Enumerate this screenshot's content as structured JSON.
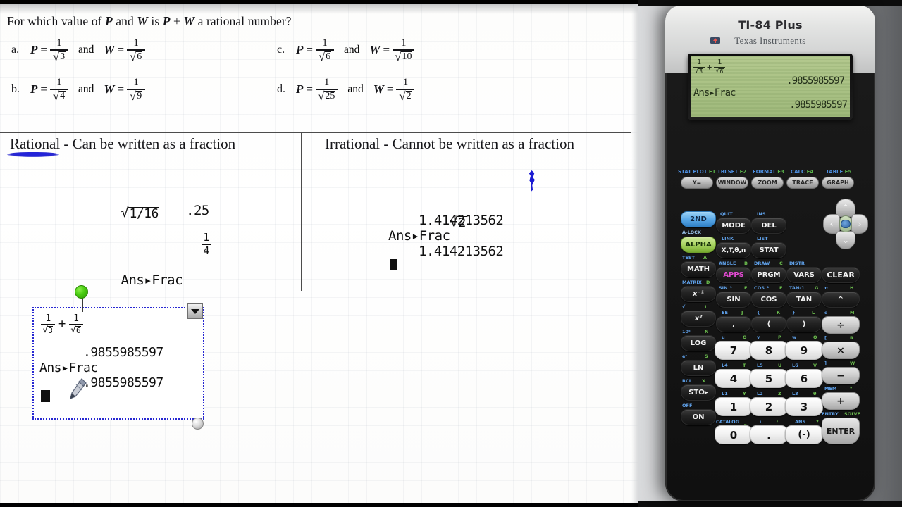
{
  "question": {
    "prompt_parts": [
      "For which value of ",
      "P",
      " and ",
      "W",
      " is ",
      "P",
      " + ",
      "W",
      " a rational number?"
    ],
    "prompt_plain": "For which value of P and W is P + W a rational number?",
    "choices": [
      {
        "letter": "a.",
        "p_den": "3",
        "w_den": "6"
      },
      {
        "letter": "b.",
        "p_den": "4",
        "w_den": "9"
      },
      {
        "letter": "c.",
        "p_den": "6",
        "w_den": "10"
      },
      {
        "letter": "d.",
        "p_den": "25",
        "w_den": "2"
      }
    ],
    "var_p": "P",
    "var_w": "W",
    "eq": "=",
    "and": "and",
    "one": "1",
    "radical": "√"
  },
  "table": {
    "rational_heading": "Rational - Can be written as a fraction",
    "irrational_heading": "Irrational - Cannot be written as a fraction",
    "rational_example": {
      "entry_radicand": "1/16",
      "command": "Ans▸Frac",
      "decimal_result": ".25",
      "fraction_num": "1",
      "fraction_den": "4"
    },
    "irrational_example": {
      "entry_radicand": "2",
      "decimal_result": "1.414213562",
      "command": "Ans▸Frac",
      "frac_result": "1.414213562"
    }
  },
  "selected_object": {
    "line_expr_left_num": "1",
    "line_expr_left_den": "3",
    "plus": "+",
    "line_expr_right_num": "1",
    "line_expr_right_den": "6",
    "result1": ".9855985597",
    "command": "Ans▸Frac",
    "result2": ".9855985597",
    "handles": {
      "rotation": "rotation-handle",
      "dropdown": "dropdown-arrow",
      "resize": "resize-handle"
    }
  },
  "calculator": {
    "model": "TI-84 Plus",
    "brand": "Texas Instruments",
    "screen": {
      "expr_num1": "1",
      "expr_den1": "3",
      "plus": "+",
      "expr_num2": "1",
      "expr_den2": "6",
      "result1": ".9855985597",
      "command": "Ans▸Frac",
      "result2": ".9855985597"
    },
    "function_keys": [
      {
        "label": "Y=",
        "second": "STAT PLOT",
        "f": "F1"
      },
      {
        "label": "WINDOW",
        "second": "TBLSET",
        "f": "F2"
      },
      {
        "label": "ZOOM",
        "second": "FORMAT",
        "f": "F3"
      },
      {
        "label": "TRACE",
        "second": "CALC",
        "f": "F4"
      },
      {
        "label": "GRAPH",
        "second": "TABLE",
        "f": "F5"
      }
    ],
    "keys": [
      {
        "label": "2ND",
        "style": "blue",
        "second": "",
        "alpha": ""
      },
      {
        "label": "MODE",
        "style": "dark",
        "second": "QUIT",
        "alpha": ""
      },
      {
        "label": "DEL",
        "style": "dark",
        "second": "INS",
        "alpha": ""
      },
      {
        "label": "ALPHA",
        "style": "green",
        "second": "A-LOCK",
        "alpha": ""
      },
      {
        "label": "X,T,θ,n",
        "style": "dark",
        "second": "LINK",
        "alpha": ""
      },
      {
        "label": "STAT",
        "style": "dark",
        "second": "LIST",
        "alpha": ""
      },
      {
        "label": "MATH",
        "style": "dark",
        "second": "TEST",
        "alpha": "A"
      },
      {
        "label": "APPS",
        "style": "magenta",
        "second": "ANGLE",
        "alpha": "B"
      },
      {
        "label": "PRGM",
        "style": "dark",
        "second": "DRAW",
        "alpha": "C"
      },
      {
        "label": "x⁻¹",
        "style": "dark",
        "second": "MATRIX",
        "alpha": "D"
      },
      {
        "label": "SIN",
        "style": "dark",
        "second": "SIN⁻¹",
        "alpha": "E"
      },
      {
        "label": "COS",
        "style": "dark",
        "second": "COS⁻¹",
        "alpha": "F"
      },
      {
        "label": "TAN",
        "style": "dark",
        "second": "TAN-1",
        "alpha": "G"
      },
      {
        "label": "VARS",
        "style": "dark",
        "second": "DISTR",
        "alpha": ""
      },
      {
        "label": "CLEAR",
        "style": "dark",
        "second": "",
        "alpha": ""
      },
      {
        "label": "x²",
        "style": "dark",
        "second": "√",
        "alpha": "I"
      },
      {
        "label": ",",
        "style": "dark",
        "second": "EE",
        "alpha": "J"
      },
      {
        "label": "(",
        "style": "dark",
        "second": "{",
        "alpha": "K"
      },
      {
        "label": ")",
        "style": "dark",
        "second": "}",
        "alpha": "L"
      },
      {
        "label": "^",
        "style": "dark",
        "second": "π",
        "alpha": "H"
      },
      {
        "label": "LOG",
        "style": "dark",
        "second": "10ˣ",
        "alpha": "N"
      },
      {
        "label": "LN",
        "style": "dark",
        "second": "eˣ",
        "alpha": "S"
      },
      {
        "label": "STO▸",
        "style": "dark",
        "second": "RCL",
        "alpha": "X"
      },
      {
        "label": "ON",
        "style": "dark",
        "second": "OFF",
        "alpha": ""
      },
      {
        "label": "7",
        "style": "white",
        "second": "u",
        "alpha": "O"
      },
      {
        "label": "8",
        "style": "white",
        "second": "v",
        "alpha": "P"
      },
      {
        "label": "9",
        "style": "white",
        "second": "w",
        "alpha": "Q"
      },
      {
        "label": "4",
        "style": "white",
        "second": "L4",
        "alpha": "T"
      },
      {
        "label": "5",
        "style": "white",
        "second": "L5",
        "alpha": "U"
      },
      {
        "label": "6",
        "style": "white",
        "second": "L6",
        "alpha": "V"
      },
      {
        "label": "1",
        "style": "white",
        "second": "L1",
        "alpha": "Y"
      },
      {
        "label": "2",
        "style": "white",
        "second": "L2",
        "alpha": "Z"
      },
      {
        "label": "3",
        "style": "white",
        "second": "L3",
        "alpha": "θ"
      },
      {
        "label": "0",
        "style": "white",
        "second": "CATALOG",
        "alpha": "_"
      },
      {
        "label": ".",
        "style": "white",
        "second": "i",
        "alpha": ":"
      },
      {
        "label": "(-)",
        "style": "white",
        "second": "ANS",
        "alpha": "?"
      },
      {
        "label": "÷",
        "style": "gray",
        "second": "e",
        "alpha": "M"
      },
      {
        "label": "×",
        "style": "gray",
        "second": "[",
        "alpha": "R"
      },
      {
        "label": "−",
        "style": "gray",
        "second": "]",
        "alpha": "W"
      },
      {
        "label": "+",
        "style": "gray",
        "second": "MEM",
        "alpha": "\""
      },
      {
        "label": "ENTER",
        "style": "enter",
        "second": "ENTRY",
        "alpha": "SOLVE"
      }
    ],
    "dpad": {
      "up": "⌃",
      "down": "⌄",
      "left": "‹",
      "right": "›"
    }
  }
}
